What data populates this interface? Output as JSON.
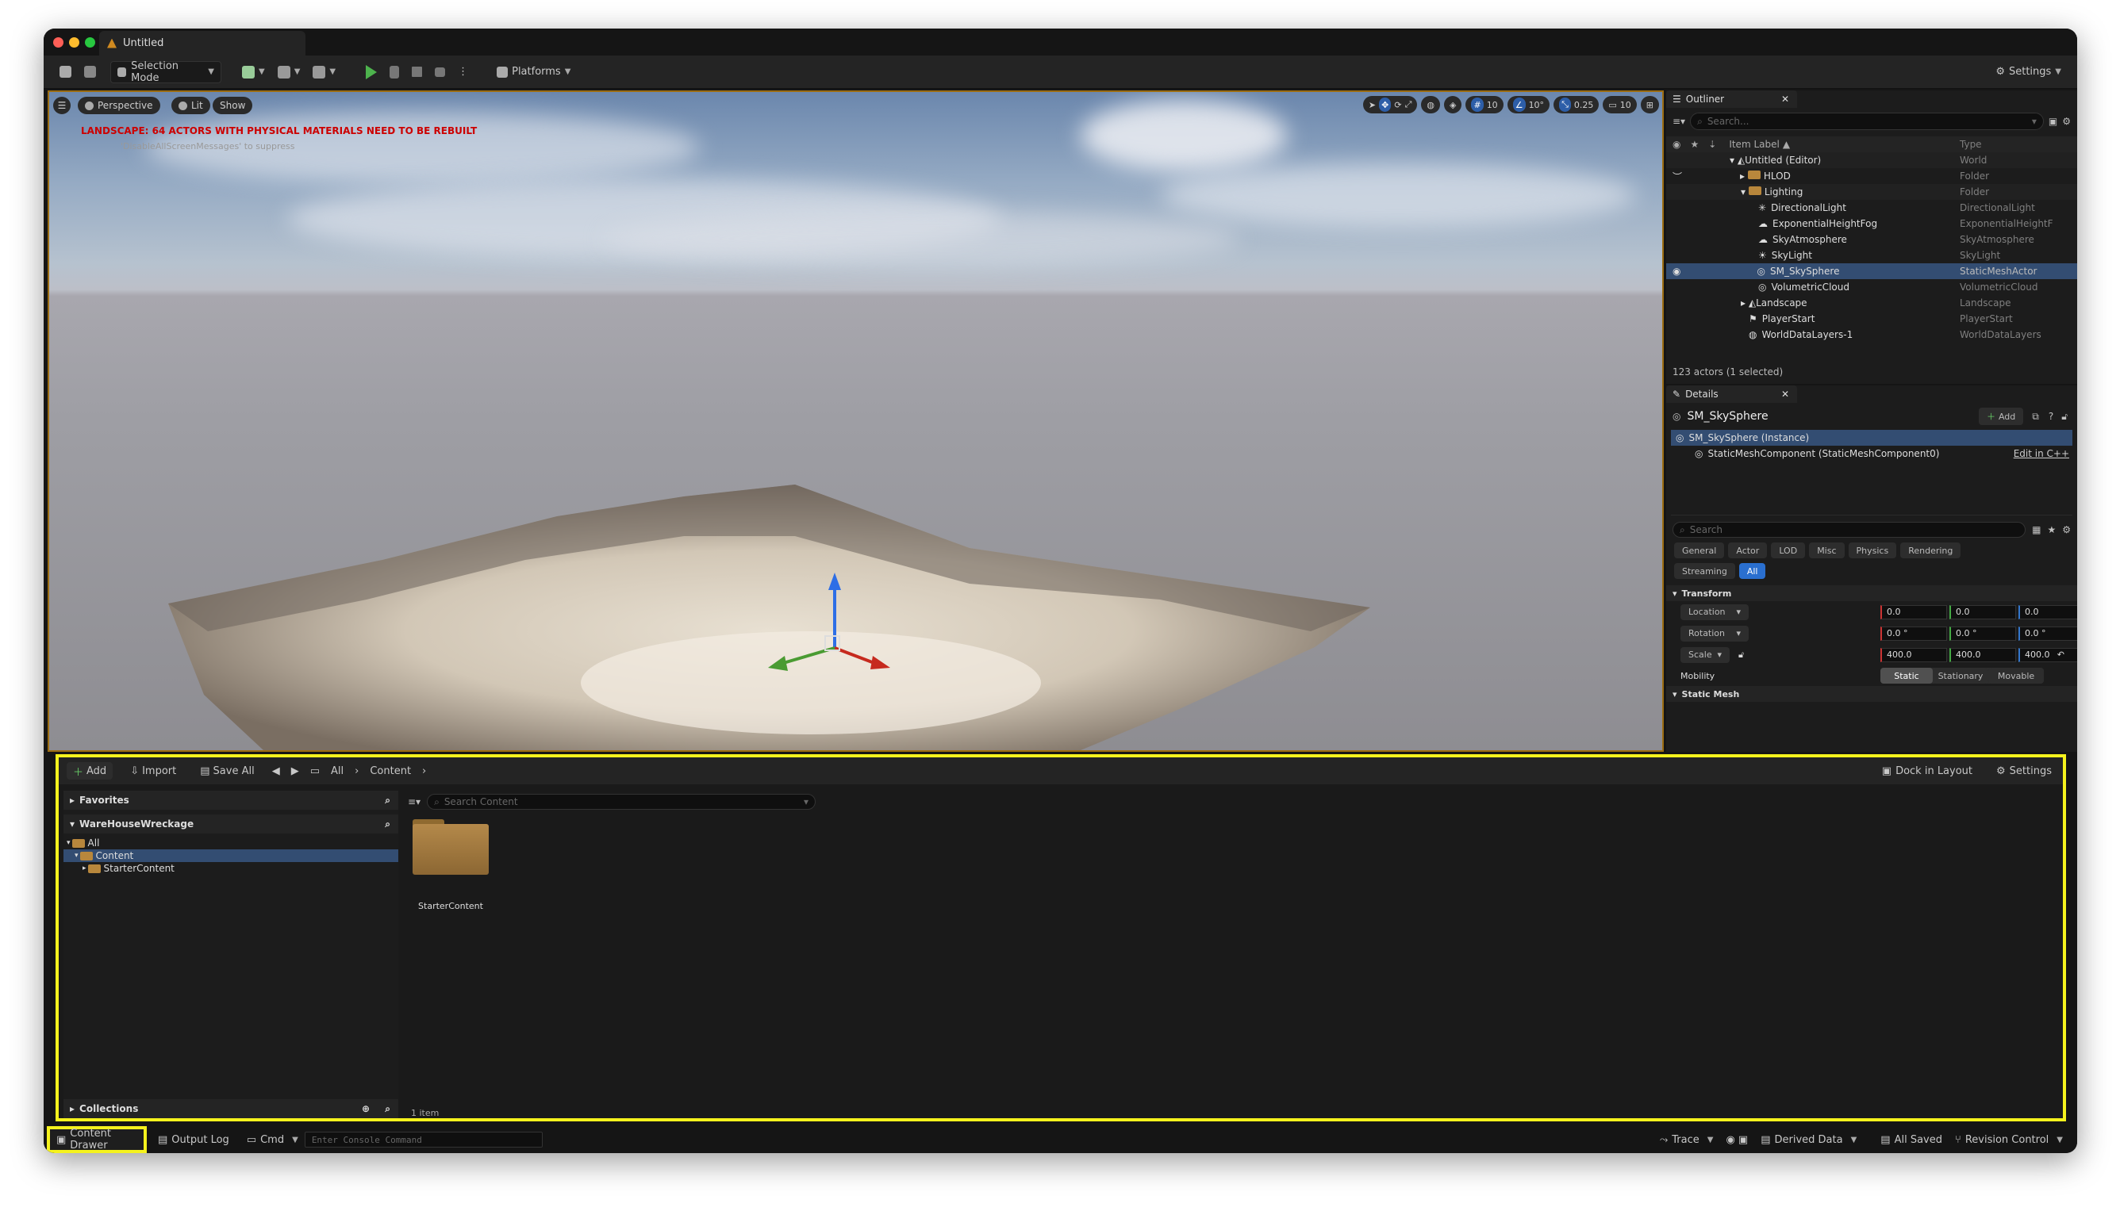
{
  "window": {
    "title": "Untitled"
  },
  "toolbar": {
    "selection_mode": "Selection Mode",
    "platforms": "Platforms",
    "settings": "Settings"
  },
  "viewport": {
    "perspective": "Perspective",
    "lit": "Lit",
    "show": "Show",
    "warning": "LANDSCAPE: 64 ACTORS WITH PHYSICAL MATERIALS NEED TO BE REBUILT",
    "warning_sub": "'DisableAllScreenMessages' to suppress",
    "grid_snap": "10",
    "rot_snap": "10°",
    "scale_snap": "0.25",
    "camera_speed": "10"
  },
  "outliner": {
    "tab": "Outliner",
    "search_placeholder": "Search...",
    "col_label": "Item Label",
    "col_type": "Type",
    "rows": [
      {
        "label": "Untitled (Editor)",
        "type": "World"
      },
      {
        "label": "HLOD",
        "type": "Folder"
      },
      {
        "label": "Lighting",
        "type": "Folder"
      },
      {
        "label": "DirectionalLight",
        "type": "DirectionalLight"
      },
      {
        "label": "ExponentialHeightFog",
        "type": "ExponentialHeightF"
      },
      {
        "label": "SkyAtmosphere",
        "type": "SkyAtmosphere"
      },
      {
        "label": "SkyLight",
        "type": "SkyLight"
      },
      {
        "label": "SM_SkySphere",
        "type": "StaticMeshActor"
      },
      {
        "label": "VolumetricCloud",
        "type": "VolumetricCloud"
      },
      {
        "label": "Landscape",
        "type": "Landscape"
      },
      {
        "label": "PlayerStart",
        "type": "PlayerStart"
      },
      {
        "label": "WorldDataLayers-1",
        "type": "WorldDataLayers"
      }
    ],
    "status": "123 actors (1 selected)"
  },
  "details": {
    "tab": "Details",
    "actor_name": "SM_SkySphere",
    "add": "Add",
    "instance": "SM_SkySphere (Instance)",
    "component": "StaticMeshComponent (StaticMeshComponent0)",
    "edit_cpp": "Edit in C++",
    "search_placeholder": "Search",
    "filters": [
      "General",
      "Actor",
      "LOD",
      "Misc",
      "Physics",
      "Rendering",
      "Streaming",
      "All"
    ],
    "transform": "Transform",
    "location_label": "Location",
    "rotation_label": "Rotation",
    "scale_label": "Scale",
    "location": [
      "0.0",
      "0.0",
      "0.0"
    ],
    "rotation": [
      "0.0 °",
      "0.0 °",
      "0.0 °"
    ],
    "scale": [
      "400.0",
      "400.0",
      "400.0"
    ],
    "mobility_label": "Mobility",
    "mobility": [
      "Static",
      "Stationary",
      "Movable"
    ],
    "static_mesh": "Static Mesh"
  },
  "content_drawer": {
    "add": "Add",
    "import": "Import",
    "save_all": "Save All",
    "path": [
      "All",
      "Content"
    ],
    "dock": "Dock in Layout",
    "settings": "Settings",
    "favorites": "Favorites",
    "project": "WareHouseWreckage",
    "tree": [
      "All",
      "Content",
      "StarterContent"
    ],
    "collections": "Collections",
    "search_placeholder": "Search Content",
    "asset": "StarterContent",
    "count": "1 item"
  },
  "statusbar": {
    "content_drawer": "Content Drawer",
    "output_log": "Output Log",
    "cmd": "Cmd",
    "console_placeholder": "Enter Console Command",
    "trace": "Trace",
    "derived_data": "Derived Data",
    "all_saved": "All Saved",
    "revision_control": "Revision Control"
  }
}
